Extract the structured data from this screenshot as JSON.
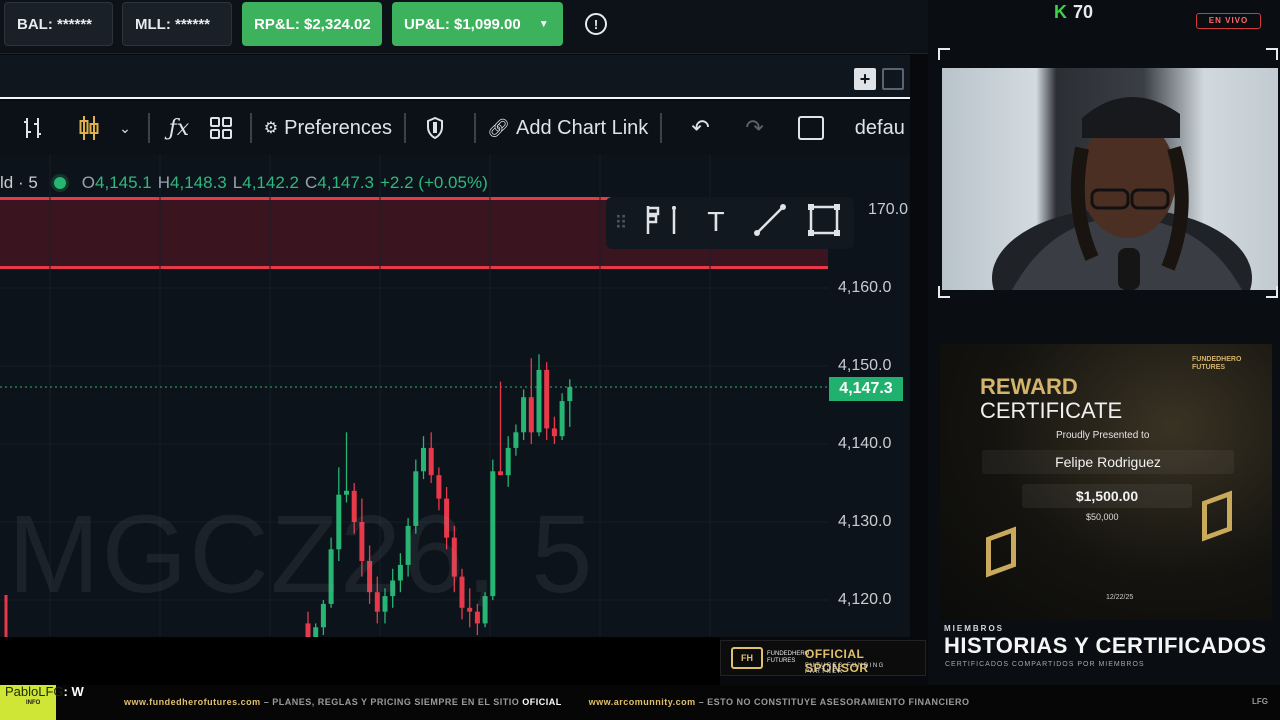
{
  "account_bar": {
    "bal": "BAL: ******",
    "mll": "MLL: ******",
    "rpl": "RP&L: $2,324.02",
    "upl": "UP&L: $1,099.00",
    "alert_icon": "alert-circle-icon"
  },
  "chart_strip": {
    "plus_icon": "+",
    "window_icon": "window-icon"
  },
  "toolbar": {
    "preferences_label": "Preferences",
    "add_chart_link_label": "Add Chart Link",
    "default_label": "defau",
    "icons": [
      "bar-type-icon",
      "candlestick-icon",
      "chevron-down-icon",
      "fx-icon",
      "grid-icon",
      "gear-icon",
      "shield-icon",
      "link-icon",
      "undo-icon",
      "redo-icon",
      "square-icon"
    ]
  },
  "chart": {
    "instrument_suffix": "ld · 5",
    "open_label": "O",
    "open": "4,145.1",
    "high_label": "H",
    "high": "4,148.3",
    "low_label": "L",
    "low": "4,142.2",
    "close_label": "C",
    "close": "4,147.3",
    "change": "+2.2 (+0.05%)",
    "current_price": "4,147.3",
    "watermark": "MGCZ26, 5",
    "price_labels": [
      "170.0",
      "4,160.0",
      "4,150.0",
      "4,140.0",
      "4,130.0",
      "4,120.0"
    ],
    "colors": {
      "up": "#27b574",
      "down": "#e8394b",
      "zone": "#3a1520",
      "background": "#0d131a"
    },
    "draw_tools": [
      "grip-icon",
      "flag-icon",
      "text-icon",
      "line-icon",
      "rectangle-icon"
    ]
  },
  "chart_data": {
    "type": "candlestick",
    "title": "",
    "xlabel": "",
    "ylabel": "",
    "ylim": [
      4112,
      4173
    ],
    "zone": [
      4162,
      4171
    ],
    "current": 4147.3,
    "candles": [
      {
        "o": 4117.0,
        "h": 4118.5,
        "l": 4114.5,
        "c": 4115.0
      },
      {
        "o": 4114.5,
        "h": 4117.0,
        "l": 4113.5,
        "c": 4116.5
      },
      {
        "o": 4116.5,
        "h": 4120.0,
        "l": 4115.5,
        "c": 4119.5
      },
      {
        "o": 4119.5,
        "h": 4128.0,
        "l": 4119.0,
        "c": 4126.5
      },
      {
        "o": 4126.5,
        "h": 4137.0,
        "l": 4125.0,
        "c": 4133.5
      },
      {
        "o": 4133.5,
        "h": 4141.5,
        "l": 4132.5,
        "c": 4134.0
      },
      {
        "o": 4134.0,
        "h": 4135.0,
        "l": 4128.5,
        "c": 4130.0
      },
      {
        "o": 4130.0,
        "h": 4133.0,
        "l": 4123.0,
        "c": 4125.0
      },
      {
        "o": 4125.0,
        "h": 4127.0,
        "l": 4119.5,
        "c": 4121.0
      },
      {
        "o": 4121.0,
        "h": 4123.0,
        "l": 4117.0,
        "c": 4118.5
      },
      {
        "o": 4118.5,
        "h": 4121.5,
        "l": 4117.0,
        "c": 4120.5
      },
      {
        "o": 4120.5,
        "h": 4124.0,
        "l": 4119.0,
        "c": 4122.5
      },
      {
        "o": 4122.5,
        "h": 4126.0,
        "l": 4121.0,
        "c": 4124.5
      },
      {
        "o": 4124.5,
        "h": 4130.5,
        "l": 4123.0,
        "c": 4129.5
      },
      {
        "o": 4129.5,
        "h": 4138.0,
        "l": 4128.5,
        "c": 4136.5
      },
      {
        "o": 4136.5,
        "h": 4141.0,
        "l": 4135.5,
        "c": 4139.5
      },
      {
        "o": 4139.5,
        "h": 4141.5,
        "l": 4135.0,
        "c": 4136.0
      },
      {
        "o": 4136.0,
        "h": 4137.0,
        "l": 4131.5,
        "c": 4133.0
      },
      {
        "o": 4133.0,
        "h": 4134.5,
        "l": 4126.5,
        "c": 4128.0
      },
      {
        "o": 4128.0,
        "h": 4129.5,
        "l": 4121.0,
        "c": 4123.0
      },
      {
        "o": 4123.0,
        "h": 4124.0,
        "l": 4117.5,
        "c": 4119.0
      },
      {
        "o": 4119.0,
        "h": 4121.5,
        "l": 4116.5,
        "c": 4118.5
      },
      {
        "o": 4118.5,
        "h": 4119.5,
        "l": 4115.5,
        "c": 4117.0
      },
      {
        "o": 4117.0,
        "h": 4121.0,
        "l": 4116.5,
        "c": 4120.5
      },
      {
        "o": 4120.5,
        "h": 4138.0,
        "l": 4120.0,
        "c": 4136.5
      },
      {
        "o": 4136.5,
        "h": 4148.0,
        "l": 4136.0,
        "c": 4136.0
      },
      {
        "o": 4136.0,
        "h": 4141.0,
        "l": 4134.5,
        "c": 4139.5
      },
      {
        "o": 4139.5,
        "h": 4142.5,
        "l": 4138.5,
        "c": 4141.5
      },
      {
        "o": 4141.5,
        "h": 4147.0,
        "l": 4140.5,
        "c": 4146.0
      },
      {
        "o": 4146.0,
        "h": 4151.0,
        "l": 4140.0,
        "c": 4141.5
      },
      {
        "o": 4141.5,
        "h": 4151.5,
        "l": 4141.0,
        "c": 4149.5
      },
      {
        "o": 4149.5,
        "h": 4150.5,
        "l": 4140.5,
        "c": 4142.0
      },
      {
        "o": 4142.0,
        "h": 4143.5,
        "l": 4140.0,
        "c": 4141.0
      },
      {
        "o": 4141.0,
        "h": 4146.5,
        "l": 4140.5,
        "c": 4145.5
      },
      {
        "o": 4145.5,
        "h": 4148.3,
        "l": 4142.2,
        "c": 4147.3
      }
    ]
  },
  "stream": {
    "k_label": "K",
    "k_count": "70",
    "live_badge": "EN VIVO"
  },
  "certificate": {
    "brand": "FUNDEDHERO FUTURES",
    "title_line1": "REWARD",
    "title_line2": "CERTIFICATE",
    "presented": "Proudly Presented to",
    "name": "Felipe Rodriguez",
    "amount": "$1,500.00",
    "account_size": "$50,000",
    "date": "12/22/25"
  },
  "members": {
    "label": "MIEMBROS",
    "title": "HISTORIAS Y CERTIFICADOS",
    "subtitle": "CERTIFICADOS COMPARTIDOS POR MIEMBROS"
  },
  "sponsor": {
    "logo_text": "FH",
    "brand": "FUNDEDHERO FUTURES",
    "title": "OFFICIAL SPONSOR",
    "subtitle": "FUTURES FUNDING PARTNER"
  },
  "chat": {
    "user": "PabloLFG",
    "message": ": W",
    "info": "INFO"
  },
  "ticker": {
    "site1": "www.fundedherofutures.com",
    "msg1": "PLANES, REGLAS Y PRICING SIEMPRE EN EL SITIO",
    "msg1_em": "OFICIAL",
    "site2": "www.arcomunnity.com",
    "msg2": "ESTO NO CONSTITUYE ASESORAMIENTO FINANCIERO",
    "end": "LFG"
  }
}
